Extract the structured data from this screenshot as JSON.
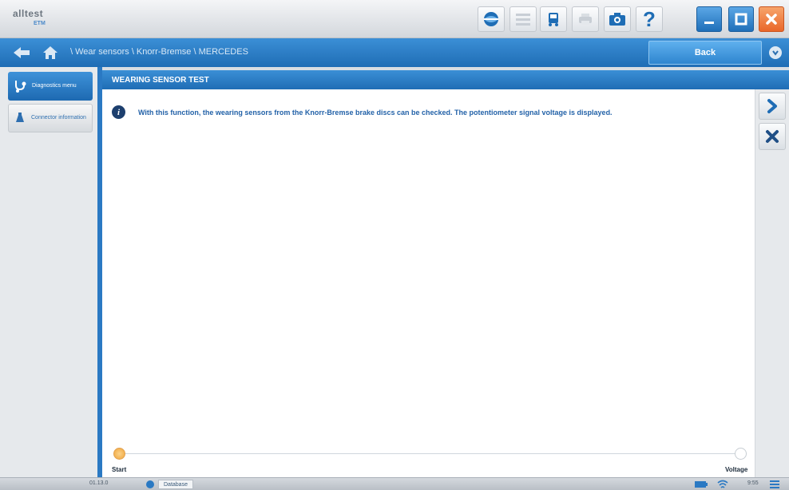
{
  "app": {
    "logo_text": "alltest",
    "logo_sub": "ETM"
  },
  "colors": {
    "accent": "#2a79c3",
    "window_close": "#e9672a",
    "info_text": "#2362a8"
  },
  "toolbar": {
    "icons": [
      "browser-icon",
      "list-icon",
      "truck-icon",
      "printer-icon",
      "camera-icon",
      "help-icon"
    ],
    "help_label": "?"
  },
  "window": {
    "icons": [
      "minimize-icon",
      "maximize-icon",
      "close-icon"
    ]
  },
  "nav": {
    "breadcrumb": "\\ Wear sensors \\ Knorr-Bremse \\ MERCEDES",
    "back_button": "Back"
  },
  "sidebar": {
    "items": [
      {
        "label": "Diagnostics menu",
        "icon": "stethoscope-icon",
        "active": true
      },
      {
        "label": "Connector information",
        "icon": "connector-icon",
        "active": false
      }
    ]
  },
  "panel": {
    "title": "WEARING SENSOR TEST",
    "info_icon": "i",
    "info_text": "With this function, the wearing sensors from the Knorr-Bremse brake discs can be checked. The potentiometer signal voltage is displayed.",
    "start_label": "Start",
    "end_label": "Voltage"
  },
  "actions": {
    "icons": [
      "next-icon",
      "cancel-icon"
    ]
  },
  "status": {
    "version": "01.13.0",
    "chip_label": "Database",
    "time": "9:55"
  }
}
